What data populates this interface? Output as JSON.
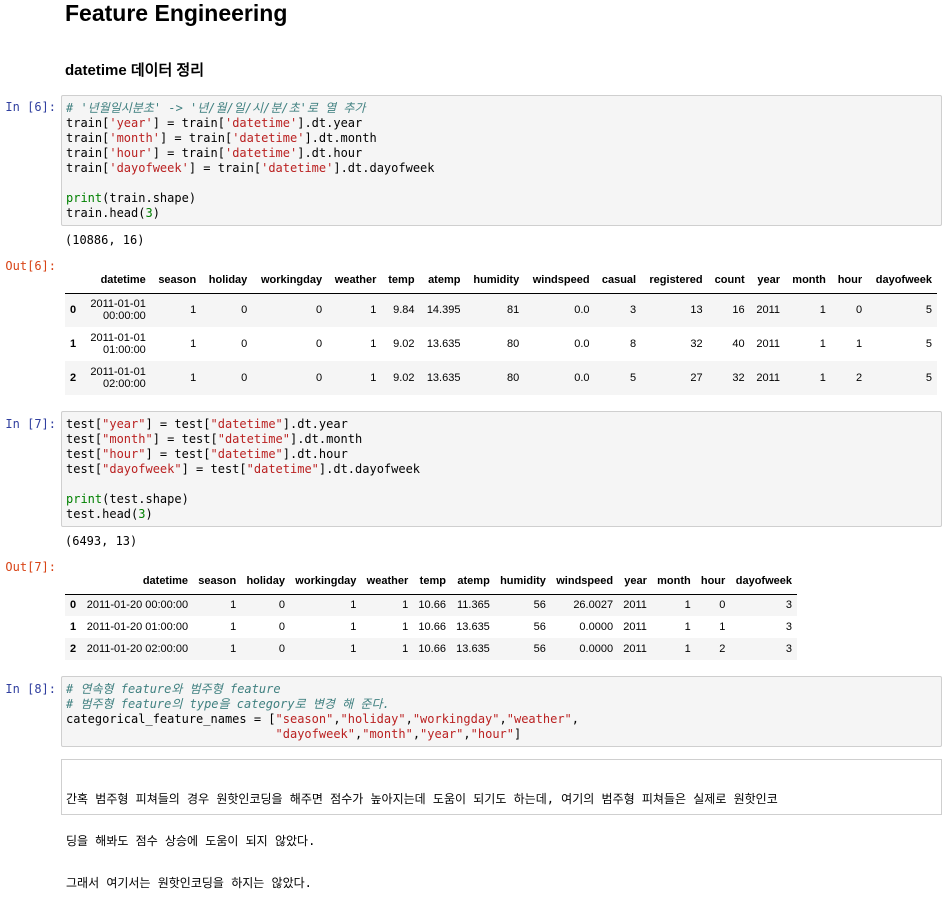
{
  "title": "Feature Engineering",
  "subtitle": "datetime 데이터 정리",
  "cells": [
    {
      "prompt": "In [6]:",
      "lines": [
        [
          {
            "t": "# '년월일시분초' -> '년/월/일/시/분/초'로 열 추가",
            "c": "c"
          }
        ],
        [
          {
            "t": "train["
          },
          {
            "t": "'year'",
            "c": "s"
          },
          {
            "t": "] = train["
          },
          {
            "t": "'datetime'",
            "c": "s"
          },
          {
            "t": "].dt.year"
          }
        ],
        [
          {
            "t": "train["
          },
          {
            "t": "'month'",
            "c": "s"
          },
          {
            "t": "] = train["
          },
          {
            "t": "'datetime'",
            "c": "s"
          },
          {
            "t": "].dt.month"
          }
        ],
        [
          {
            "t": "train["
          },
          {
            "t": "'hour'",
            "c": "s"
          },
          {
            "t": "] = train["
          },
          {
            "t": "'datetime'",
            "c": "s"
          },
          {
            "t": "].dt.hour"
          }
        ],
        [
          {
            "t": "train["
          },
          {
            "t": "'dayofweek'",
            "c": "s"
          },
          {
            "t": "] = train["
          },
          {
            "t": "'datetime'",
            "c": "s"
          },
          {
            "t": "].dt.dayofweek"
          }
        ],
        [
          {
            "t": " "
          }
        ],
        [
          {
            "t": "print",
            "c": "k"
          },
          {
            "t": "(train.shape)"
          }
        ],
        [
          {
            "t": "train.head("
          },
          {
            "t": "3",
            "c": "n"
          },
          {
            "t": ")"
          }
        ]
      ]
    },
    {
      "prompt": "In [7]:",
      "lines": [
        [
          {
            "t": "test["
          },
          {
            "t": "\"year\"",
            "c": "s"
          },
          {
            "t": "] = test["
          },
          {
            "t": "\"datetime\"",
            "c": "s"
          },
          {
            "t": "].dt.year"
          }
        ],
        [
          {
            "t": "test["
          },
          {
            "t": "\"month\"",
            "c": "s"
          },
          {
            "t": "] = test["
          },
          {
            "t": "\"datetime\"",
            "c": "s"
          },
          {
            "t": "].dt.month"
          }
        ],
        [
          {
            "t": "test["
          },
          {
            "t": "\"hour\"",
            "c": "s"
          },
          {
            "t": "] = test["
          },
          {
            "t": "\"datetime\"",
            "c": "s"
          },
          {
            "t": "].dt.hour"
          }
        ],
        [
          {
            "t": "test["
          },
          {
            "t": "\"dayofweek\"",
            "c": "s"
          },
          {
            "t": "] = test["
          },
          {
            "t": "\"datetime\"",
            "c": "s"
          },
          {
            "t": "].dt.dayofweek"
          }
        ],
        [
          {
            "t": " "
          }
        ],
        [
          {
            "t": "print",
            "c": "k"
          },
          {
            "t": "(test.shape)"
          }
        ],
        [
          {
            "t": "test.head("
          },
          {
            "t": "3",
            "c": "n"
          },
          {
            "t": ")"
          }
        ]
      ]
    },
    {
      "prompt": "In [8]:",
      "lines": [
        [
          {
            "t": "# 연속형 feature와 범주형 feature",
            "c": "c"
          }
        ],
        [
          {
            "t": "# 범주형 feature의 type을 category로 변경 해 준다.",
            "c": "c"
          }
        ],
        [
          {
            "t": "categorical_feature_names = ["
          },
          {
            "t": "\"season\"",
            "c": "s"
          },
          {
            "t": ","
          },
          {
            "t": "\"holiday\"",
            "c": "s"
          },
          {
            "t": ","
          },
          {
            "t": "\"workingday\"",
            "c": "s"
          },
          {
            "t": ","
          },
          {
            "t": "\"weather\"",
            "c": "s"
          },
          {
            "t": ","
          }
        ],
        [
          {
            "t": "                             "
          },
          {
            "t": "\"dayofweek\"",
            "c": "s"
          },
          {
            "t": ","
          },
          {
            "t": "\"month\"",
            "c": "s"
          },
          {
            "t": ","
          },
          {
            "t": "\"year\"",
            "c": "s"
          },
          {
            "t": ","
          },
          {
            "t": "\"hour\"",
            "c": "s"
          },
          {
            "t": "]"
          }
        ]
      ]
    }
  ],
  "outputs": [
    {
      "shape": "(10886, 16)",
      "prompt": "Out[6]:",
      "columns": [
        "",
        "datetime",
        "season",
        "holiday",
        "workingday",
        "weather",
        "temp",
        "atemp",
        "humidity",
        "windspeed",
        "casual",
        "registered",
        "count",
        "year",
        "month",
        "hour",
        "dayofweek"
      ],
      "rows": [
        [
          "0",
          "2011-01-01\n00:00:00",
          "1",
          "0",
          "0",
          "1",
          "9.84",
          "14.395",
          "81",
          "0.0",
          "3",
          "13",
          "16",
          "2011",
          "1",
          "0",
          "5"
        ],
        [
          "1",
          "2011-01-01\n01:00:00",
          "1",
          "0",
          "0",
          "1",
          "9.02",
          "13.635",
          "80",
          "0.0",
          "8",
          "32",
          "40",
          "2011",
          "1",
          "1",
          "5"
        ],
        [
          "2",
          "2011-01-01\n02:00:00",
          "1",
          "0",
          "0",
          "1",
          "9.02",
          "13.635",
          "80",
          "0.0",
          "5",
          "27",
          "32",
          "2011",
          "1",
          "2",
          "5"
        ]
      ]
    },
    {
      "shape": "(6493, 13)",
      "prompt": "Out[7]:",
      "columns": [
        "",
        "datetime",
        "season",
        "holiday",
        "workingday",
        "weather",
        "temp",
        "atemp",
        "humidity",
        "windspeed",
        "year",
        "month",
        "hour",
        "dayofweek"
      ],
      "rows": [
        [
          "0",
          "2011-01-20 00:00:00",
          "1",
          "0",
          "1",
          "1",
          "10.66",
          "11.365",
          "56",
          "26.0027",
          "2011",
          "1",
          "0",
          "3"
        ],
        [
          "1",
          "2011-01-20 01:00:00",
          "1",
          "0",
          "1",
          "1",
          "10.66",
          "13.635",
          "56",
          "0.0000",
          "2011",
          "1",
          "1",
          "3"
        ],
        [
          "2",
          "2011-01-20 02:00:00",
          "1",
          "0",
          "1",
          "1",
          "10.66",
          "13.635",
          "56",
          "0.0000",
          "2011",
          "1",
          "2",
          "3"
        ]
      ]
    }
  ],
  "markdown": [
    "간혹 범주형 피쳐들의 경우 원핫인코딩을 해주면 점수가 높아지는데 도움이 되기도 하는데, 여기의 범주형 피쳐들은 실제로 원핫인코",
    "딩을 해봐도 점수 상승에 도움이 되지 않았다.",
    "그래서 여기서는 원핫인코딩을 하지는 않았다."
  ]
}
